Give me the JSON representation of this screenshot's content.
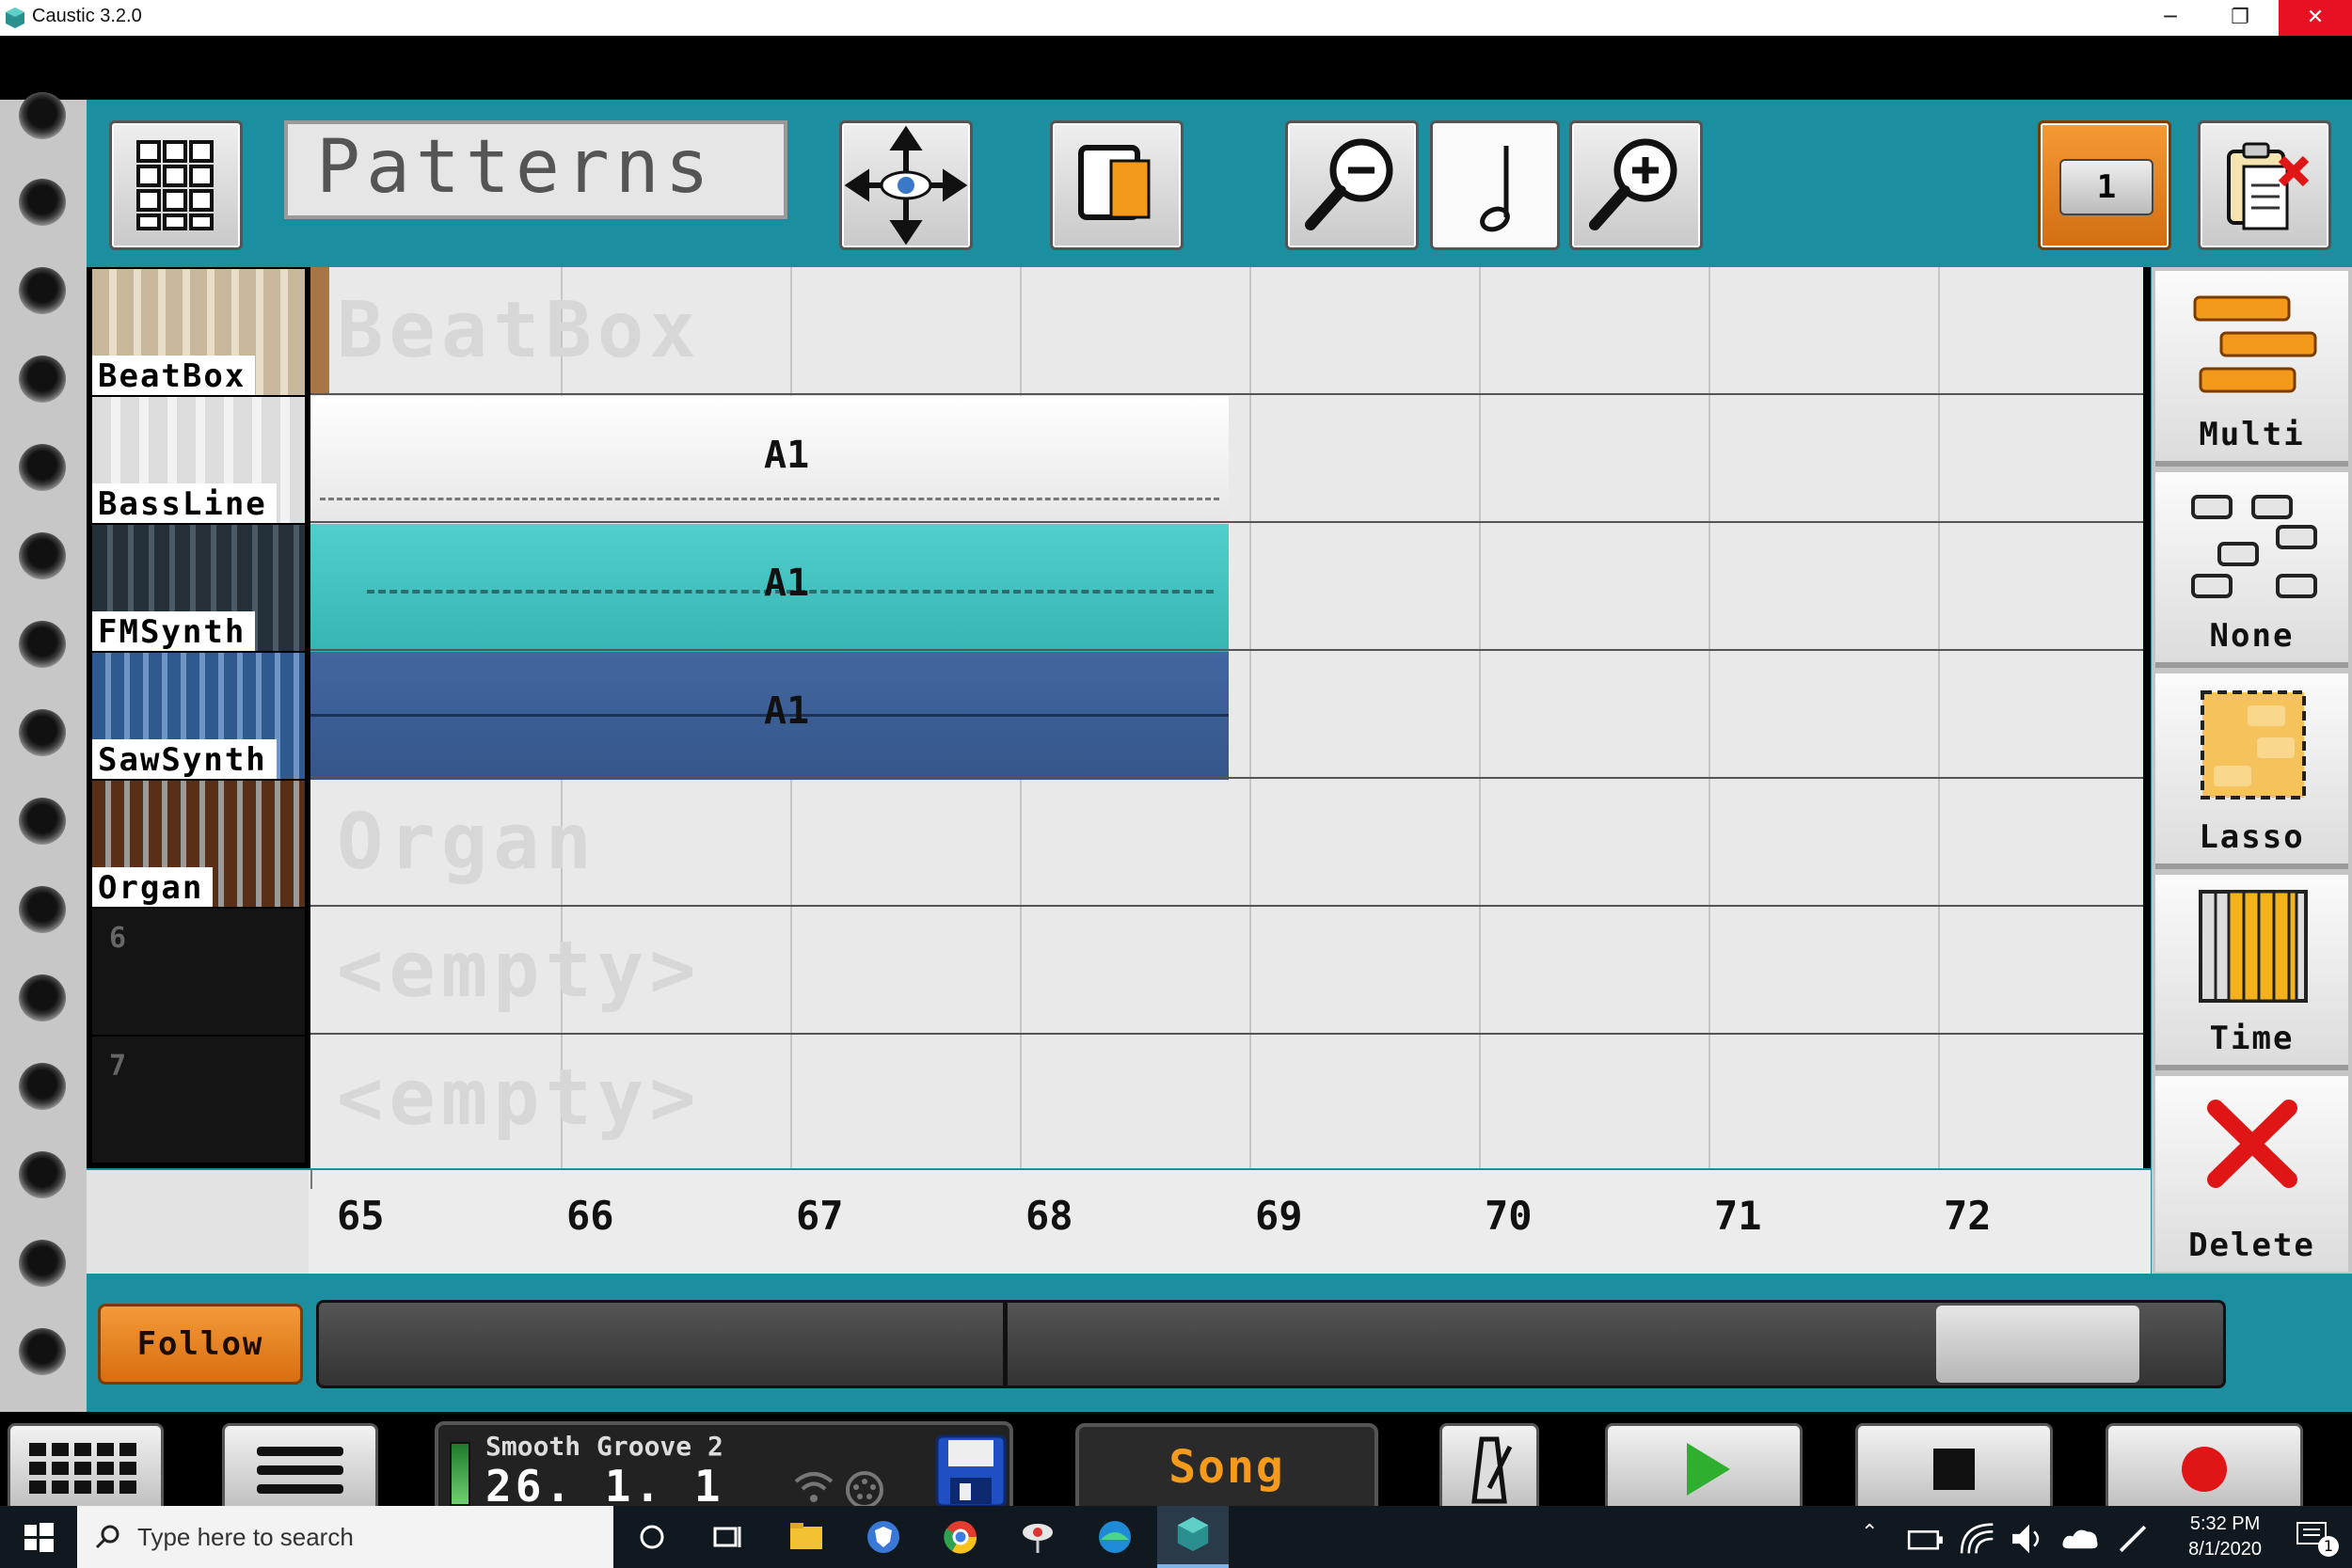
{
  "window": {
    "title": "Caustic 3.2.0",
    "minimize": "─",
    "restore": "❐",
    "close": "✕"
  },
  "toolbar": {
    "display_text": "Patterns",
    "pattern_count_badge": "1",
    "icons": [
      "grid-menu-icon",
      "move-view-icon",
      "copy-pattern-icon",
      "zoom-out-icon",
      "note-icon",
      "zoom-in-icon",
      "clipboard-delete-icon"
    ]
  },
  "tracks": [
    {
      "label": "BeatBox",
      "ghost": "BeatBox",
      "thumb_color": "#cdbfa8"
    },
    {
      "label": "BassLine",
      "ghost": "",
      "thumb_color": "#d8d8d8"
    },
    {
      "label": "FMSynth",
      "ghost": "",
      "thumb_color": "#2d3a44"
    },
    {
      "label": "SawSynth",
      "ghost": "",
      "thumb_color": "#2e5a90"
    },
    {
      "label": "Organ",
      "ghost": "Organ",
      "thumb_color": "#6b3a1e"
    },
    {
      "label": "",
      "ghost": "<empty>",
      "number": "6"
    },
    {
      "label": "",
      "ghost": "<empty>",
      "number": "7"
    }
  ],
  "patterns": [
    {
      "label": "A1",
      "color": "#f4f4f4"
    },
    {
      "label": "A1",
      "color": "#46c3c2"
    },
    {
      "label": "A1",
      "color": "#3c5f92"
    }
  ],
  "ruler": {
    "bars": [
      "65",
      "66",
      "67",
      "68",
      "69",
      "70",
      "71",
      "72"
    ]
  },
  "right_tools": [
    {
      "label": "Multi",
      "icon": "multi-select-icon"
    },
    {
      "label": "None",
      "icon": "no-select-icon"
    },
    {
      "label": "Lasso",
      "icon": "lasso-icon"
    },
    {
      "label": "Time",
      "icon": "time-icon"
    },
    {
      "label": "Delete",
      "icon": "delete-icon"
    }
  ],
  "follow_label": "Follow",
  "transport": {
    "song_name": "Smooth Groove 2",
    "position": "26. 1. 1",
    "mode": "Song",
    "icons": [
      "keypad-icon",
      "menu-icon",
      "wifi-icon",
      "midi-icon",
      "save-icon",
      "metronome-icon",
      "play-icon",
      "stop-icon",
      "record-icon"
    ]
  },
  "taskbar": {
    "search_placeholder": "Type here to search",
    "time": "5:32 PM",
    "date": "8/1/2020",
    "notification_count": "1"
  },
  "colors": {
    "teal": "#1b8fa0",
    "orange": "#f08a24",
    "play_green": "#2fae2f",
    "record_red": "#e01515"
  }
}
